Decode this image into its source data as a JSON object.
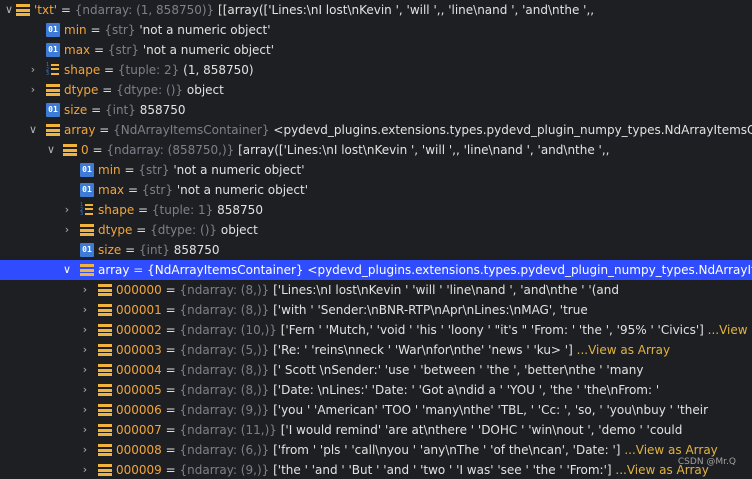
{
  "rows": [
    {
      "name": "'txt'",
      "type": "{ndarray: (1, 858750)}",
      "value": "[[array(['Lines:\\nI lost\\nKevin ', 'will                ',,        'line\\nand             ', 'and\\nthe           ',,"
    },
    {
      "name": "min",
      "type": "{str}",
      "value": "'not a numeric object'"
    },
    {
      "name": "max",
      "type": "{str}",
      "value": "'not a numeric object'"
    },
    {
      "name": "shape",
      "type": "{tuple: 2}",
      "value": "(1, 858750)"
    },
    {
      "name": "dtype",
      "type": "{dtype: ()}",
      "value": "object"
    },
    {
      "name": "size",
      "type": "{int}",
      "value": "858750"
    },
    {
      "name": "array",
      "type": "{NdArrayItemsContainer}",
      "value": "<pydevd_plugins.extensions.types.pydevd_plugin_numpy_types.NdArrayItemsContainer"
    },
    {
      "name": "0",
      "type": "{ndarray: (858750,)}",
      "value": "[array(['Lines:\\nI lost\\nKevin ', 'will                 ',,        'line\\nand             ', 'and\\nthe             ',,"
    },
    {
      "name": "min",
      "type": "{str}",
      "value": "'not a numeric object'"
    },
    {
      "name": "max",
      "type": "{str}",
      "value": "'not a numeric object'"
    },
    {
      "name": "shape",
      "type": "{tuple: 1}",
      "value": "858750"
    },
    {
      "name": "dtype",
      "type": "{dtype: ()}",
      "value": "object"
    },
    {
      "name": "size",
      "type": "{int}",
      "value": "858750"
    },
    {
      "name": "array",
      "type": "{NdArrayItemsContainer}",
      "value": "<pydevd_plugins.extensions.types.pydevd_plugin_numpy_types.NdArrayItemsContainer"
    },
    {
      "name": "000000",
      "type": "{ndarray: (8,)}",
      "value": "['Lines:\\nI lost\\nKevin ' 'will              ' 'line\\nand             ', 'and\\nthe              ' '(and"
    },
    {
      "name": "000001",
      "type": "{ndarray: (8,)}",
      "value": "['with                ' 'Sender:\\nBNR-RTP\\nApr\\nLines:\\nMAG', 'true"
    },
    {
      "name": "000002",
      "type": "{ndarray: (10,)}",
      "value": "['Fern   ' 'Mutch,' 'void   ' 'his    ' 'loony ' \"it's  \" 'From: ' 'the   ', '95%    ' 'Civics']",
      "link": "...View as"
    },
    {
      "name": "000003",
      "type": "{ndarray: (5,)}",
      "value": "['Re:         ' 'reins\\nneck ' 'War\\nfor\\nthe' 'news        ' 'ku>          ']",
      "link": "...View as Array"
    },
    {
      "name": "000004",
      "type": "{ndarray: (8,)}",
      "value": "[' Scott \\nSender:' 'use          ' 'between        ' 'the          ', 'better\\nthe     ' 'many"
    },
    {
      "name": "000005",
      "type": "{ndarray: (8,)}",
      "value": "['Date: \\nLines:' 'Date:        ' 'Got a\\ndid a   ' 'YOU           ', 'the          ' 'the\\nFrom:     '"
    },
    {
      "name": "000006",
      "type": "{ndarray: (9,)}",
      "value": "['you     ' 'American' 'TOO      ' 'many\\nthe' 'TBL,    ' 'Cc:     ', 'so,     ' 'you\\nbuy ' 'their"
    },
    {
      "name": "000007",
      "type": "{ndarray: (11,)}",
      "value": "['I would remind' 'are at\\nthere   ' 'DOHC         ' 'win\\nout       ', 'demo          ' 'could"
    },
    {
      "name": "000008",
      "type": "{ndarray: (6,)}",
      "value": "['from      ' 'pls        ' 'call\\nyou   ' 'any\\nThe    ' 'of the\\ncan', 'Date:        ']",
      "link": "...View as Array"
    },
    {
      "name": "000009",
      "type": "{ndarray: (9,)}",
      "value": "['the  ' 'and  ' 'But  ' 'and  ' 'two  ' 'I was' 'see   ' 'the   ' 'From:']",
      "link": "...View as Array"
    }
  ],
  "watermark": "CSDN @Mr.Q"
}
